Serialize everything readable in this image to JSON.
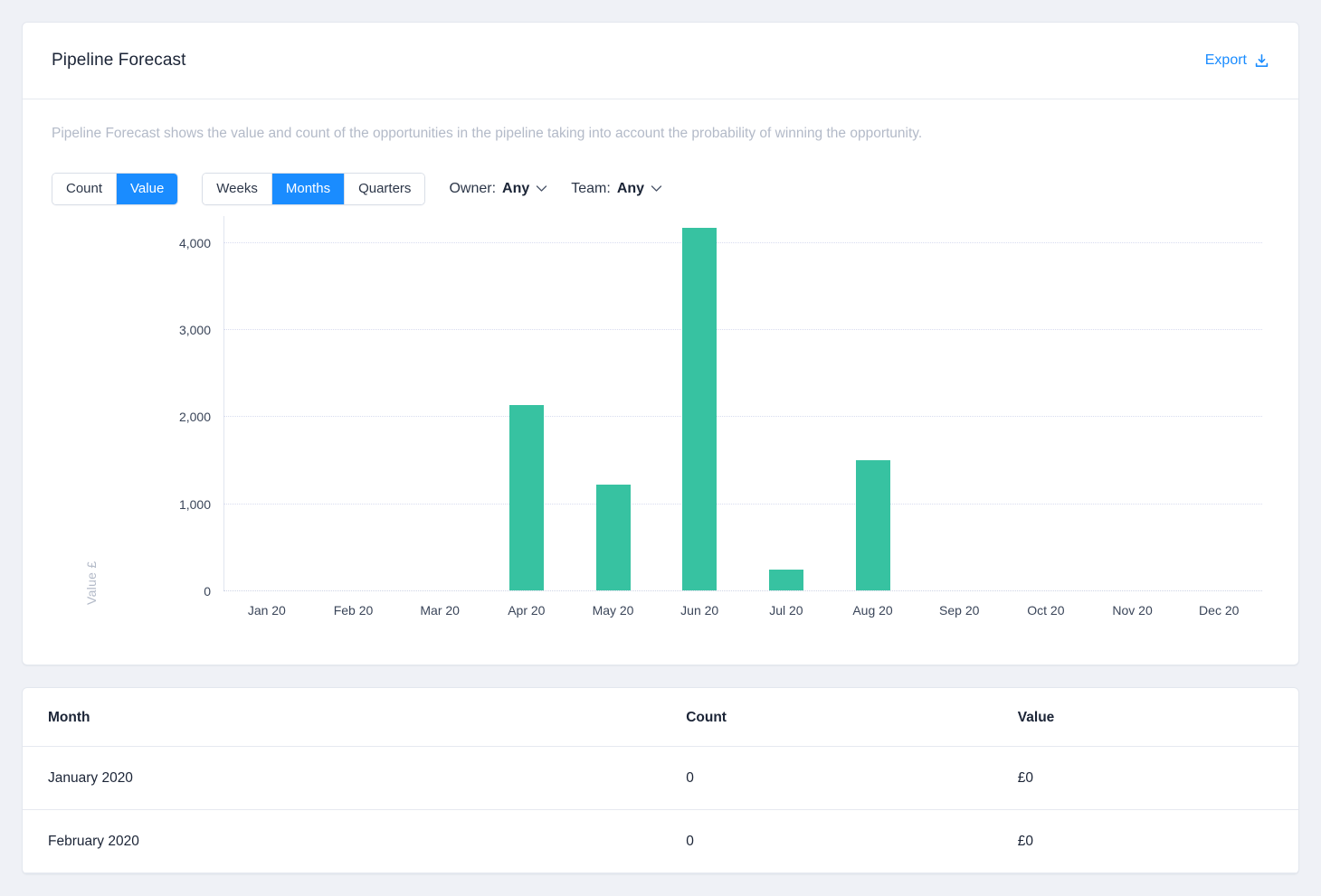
{
  "card": {
    "title": "Pipeline Forecast",
    "export_label": "Export",
    "export_icon": "download-icon",
    "description": "Pipeline Forecast shows the value and count of the opportunities in the pipeline taking into account the probability of winning the opportunity."
  },
  "controls": {
    "metric_toggle": {
      "options": [
        "Count",
        "Value"
      ],
      "active": "Value"
    },
    "period_toggle": {
      "options": [
        "Weeks",
        "Months",
        "Quarters"
      ],
      "active": "Months"
    },
    "filters": [
      {
        "label": "Owner:",
        "value": "Any",
        "icon": "chevron-down-icon"
      },
      {
        "label": "Team:",
        "value": "Any",
        "icon": "chevron-down-icon"
      }
    ]
  },
  "chart_data": {
    "type": "bar",
    "title": "",
    "xlabel": "",
    "ylabel": "Value £",
    "categories": [
      "Jan 20",
      "Feb 20",
      "Mar 20",
      "Apr 20",
      "May 20",
      "Jun 20",
      "Jul 20",
      "Aug 20",
      "Sep 20",
      "Oct 20",
      "Nov 20",
      "Dec 20"
    ],
    "values": [
      0,
      0,
      0,
      2125,
      1215,
      4165,
      240,
      1500,
      0,
      0,
      0,
      0
    ],
    "ylim": [
      0,
      4300
    ],
    "yticks": [
      0,
      1000,
      2000,
      3000,
      4000
    ],
    "ytick_labels": [
      "0",
      "1,000",
      "2,000",
      "3,000",
      "4,000"
    ],
    "grid": true,
    "legend": false,
    "bar_color": "#37c2a1"
  },
  "table": {
    "columns": [
      "Month",
      "Count",
      "Value"
    ],
    "rows": [
      {
        "month": "January 2020",
        "count": "0",
        "value": "£0"
      },
      {
        "month": "February 2020",
        "count": "0",
        "value": "£0"
      }
    ]
  },
  "colors": {
    "accent": "#1a8cff",
    "bar": "#37c2a1",
    "page_bg": "#eff1f6",
    "text": "#1b2436",
    "muted": "#b3bac8"
  }
}
